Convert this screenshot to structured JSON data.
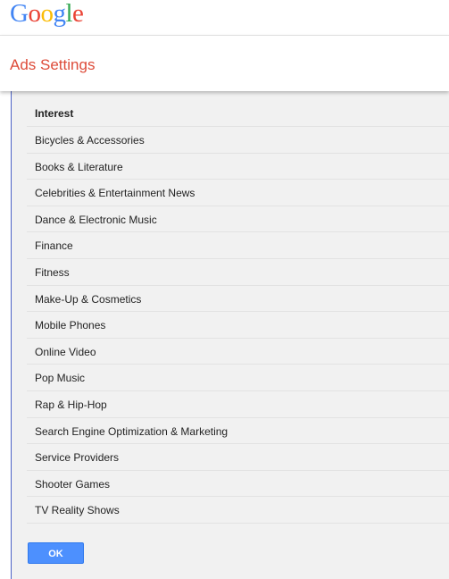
{
  "header": {
    "logo_letters": [
      "G",
      "o",
      "o",
      "g",
      "l",
      "e"
    ],
    "logo_colors": [
      "#4285f4",
      "#ea4335",
      "#fbbc05",
      "#4285f4",
      "#34a853",
      "#ea4335"
    ],
    "title": "Ads Settings"
  },
  "dialog": {
    "column_header": "Interest",
    "items": [
      "Bicycles & Accessories",
      "Books & Literature",
      "Celebrities & Entertainment News",
      "Dance & Electronic Music",
      "Finance",
      "Fitness",
      "Make-Up & Cosmetics",
      "Mobile Phones",
      "Online Video",
      "Pop Music",
      "Rap & Hip-Hop",
      "Search Engine Optimization & Marketing",
      "Service Providers",
      "Shooter Games",
      "TV Reality Shows"
    ],
    "ok_label": "OK"
  },
  "colors": {
    "title_red": "#dd4b39",
    "button_blue": "#4d90fe",
    "dialog_bg": "#f1f1f1"
  }
}
